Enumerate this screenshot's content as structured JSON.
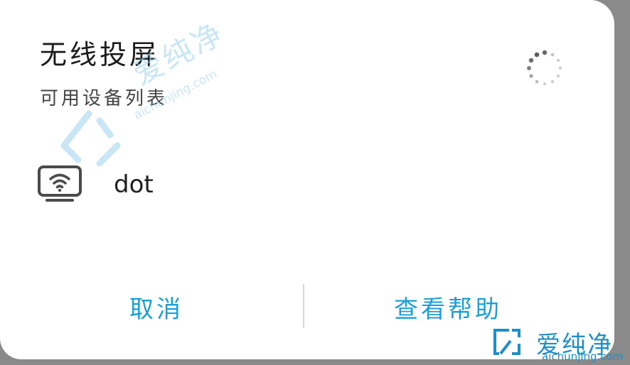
{
  "dialog": {
    "title": "无线投屏",
    "subtitle": "可用设备列表",
    "devices": [
      {
        "name": "dot",
        "icon": "screen-cast-icon"
      }
    ],
    "cancel_label": "取消",
    "help_label": "查看帮助"
  },
  "watermark": {
    "text": "爱纯净",
    "url": "aichunjing.com"
  },
  "colors": {
    "accent": "#1aa0d6",
    "background": "#ffffff",
    "watermark": "#9dd3ee"
  }
}
